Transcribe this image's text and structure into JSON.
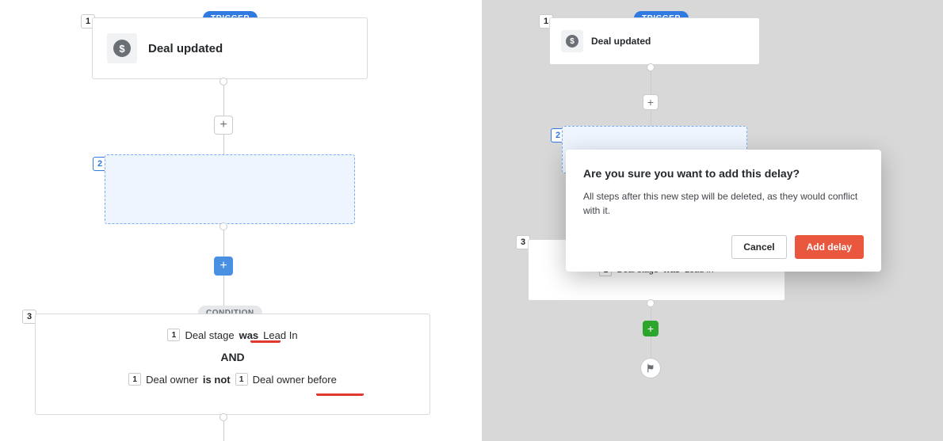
{
  "left": {
    "step1": {
      "num": "1",
      "badge": "TRIGGER",
      "title": "Deal updated",
      "icon": "$"
    },
    "step2": {
      "num": "2"
    },
    "step3": {
      "num": "3",
      "badge": "CONDITION",
      "row1": {
        "chip": "1",
        "field": "Deal stage",
        "op": "was",
        "value": "Lead In"
      },
      "join": "AND",
      "row2": {
        "chip_a": "1",
        "field_a": "Deal owner",
        "op": "is not",
        "chip_b": "1",
        "field_b": "Deal owner before"
      }
    }
  },
  "right": {
    "step1": {
      "num": "1",
      "badge": "TRIGGER",
      "title": "Deal updated",
      "icon": "$"
    },
    "step2": {
      "num": "2"
    },
    "step3": {
      "num": "3",
      "row1": {
        "chip": "1",
        "field": "Deal stage",
        "op": "was",
        "value": "Lead In"
      }
    },
    "modal": {
      "title": "Are you sure you want to add this delay?",
      "body": "All steps after this new step will be deleted, as they would conflict with it.",
      "cancel": "Cancel",
      "confirm": "Add delay"
    }
  }
}
